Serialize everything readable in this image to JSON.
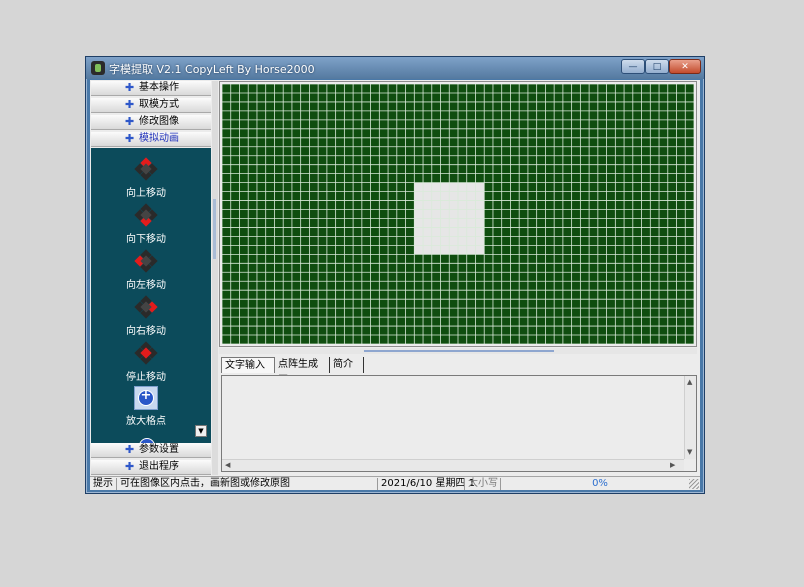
{
  "window": {
    "title": "字模提取 V2.1  CopyLeft By Horse2000",
    "buttons": {
      "minimize": "—",
      "maximize": "□",
      "close": "✕"
    }
  },
  "menu": {
    "top": [
      {
        "label": "基本操作"
      },
      {
        "label": "取模方式"
      },
      {
        "label": "修改图像"
      },
      {
        "label": "模拟动画"
      }
    ],
    "bottom": [
      {
        "label": "参数设置"
      },
      {
        "label": "退出程序"
      }
    ],
    "plus_symbol": "✚"
  },
  "anim_items": [
    {
      "label": "向上移动",
      "icon": "arrow-up-dpad-icon"
    },
    {
      "label": "向下移动",
      "icon": "arrow-down-dpad-icon"
    },
    {
      "label": "向左移动",
      "icon": "arrow-left-dpad-icon"
    },
    {
      "label": "向右移动",
      "icon": "arrow-right-dpad-icon"
    },
    {
      "label": "停止移动",
      "icon": "stop-dpad-icon"
    },
    {
      "label": "放大格点",
      "icon": "zoom-in-icon"
    }
  ],
  "grid": {
    "columns": 54,
    "rows": 29,
    "background_color": "#0f4d0f",
    "line_color": "#d9ead9",
    "highlight_color": "#e6e6e6",
    "highlight_cells": {
      "col_start": 22,
      "col_end": 30,
      "row_start": 11,
      "row_end": 19
    }
  },
  "tabs": [
    {
      "label": "文字输入区"
    },
    {
      "label": "点阵生成区"
    },
    {
      "label": "简介"
    }
  ],
  "status": {
    "label": "提示",
    "message": "可在图像区内点击，画新图或修改原图",
    "date": "2021/6/10 星期四 1",
    "caps": "大小写",
    "progress": "0%"
  }
}
